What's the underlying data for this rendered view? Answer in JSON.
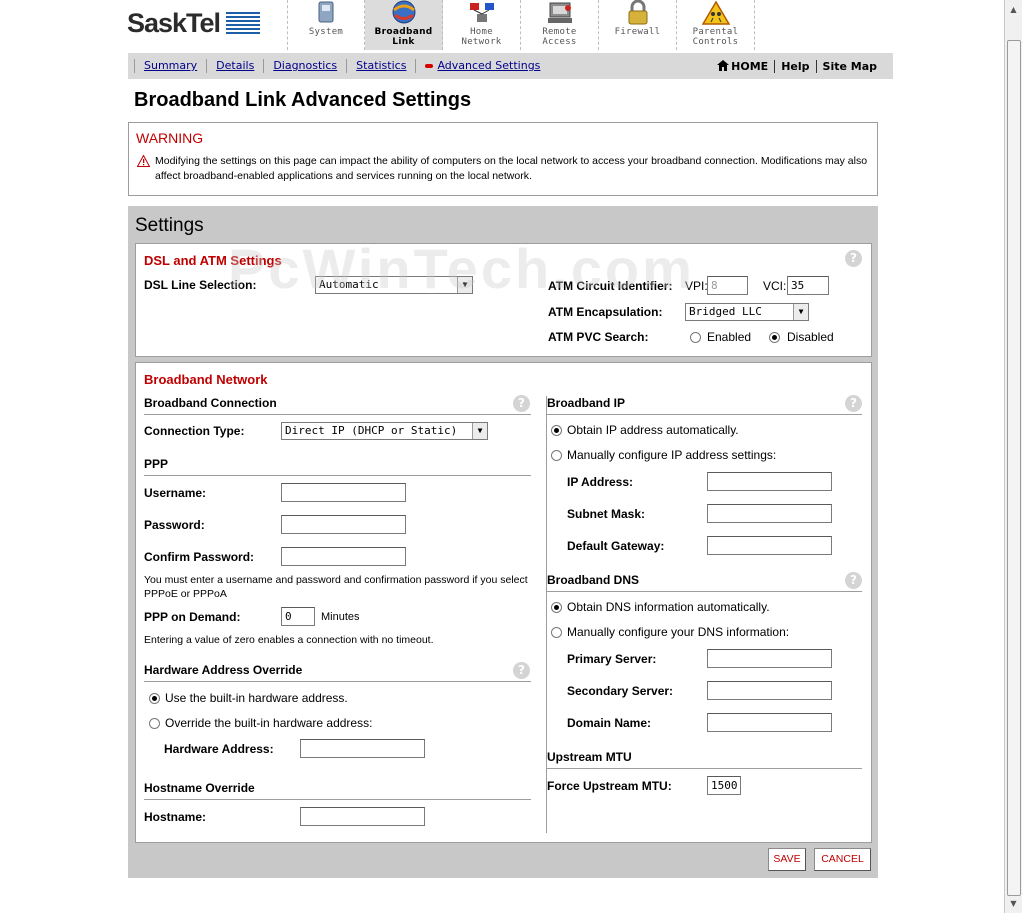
{
  "brand": {
    "name": "SaskTel"
  },
  "top_tabs": [
    {
      "label_line1": "System",
      "label_line2": "",
      "icon": "system-icon",
      "active": false
    },
    {
      "label_line1": "Broadband",
      "label_line2": "Link",
      "icon": "broadband-globe-icon",
      "active": true
    },
    {
      "label_line1": "Home",
      "label_line2": "Network",
      "icon": "home-network-icon",
      "active": false
    },
    {
      "label_line1": "Remote",
      "label_line2": "Access",
      "icon": "remote-access-icon",
      "active": false
    },
    {
      "label_line1": "Firewall",
      "label_line2": "",
      "icon": "firewall-lock-icon",
      "active": false
    },
    {
      "label_line1": "Parental",
      "label_line2": "Controls",
      "icon": "parental-controls-icon",
      "active": false
    }
  ],
  "subnav": {
    "links": [
      "Summary",
      "Details",
      "Diagnostics",
      "Statistics",
      "Advanced Settings"
    ],
    "right": {
      "home": "HOME",
      "help": "Help",
      "sitemap": "Site Map"
    }
  },
  "page_title": "Broadband Link Advanced Settings",
  "warning": {
    "title": "WARNING",
    "text": "Modifying the settings on this page can impact the ability of computers on the local network to access your broadband connection. Modifications may also affect broadband-enabled applications and services running on the local network."
  },
  "watermark": "PcWinTech.com",
  "settings_title": "Settings",
  "dsl": {
    "title": "DSL and ATM Settings",
    "line_selection_label": "DSL Line Selection:",
    "line_selection_value": "Automatic",
    "atm_circuit_label": "ATM Circuit Identifier:",
    "vpi_label": "VPI:",
    "vpi_value": "8",
    "vci_label": "VCI:",
    "vci_value": "35",
    "encapsulation_label": "ATM Encapsulation:",
    "encapsulation_value": "Bridged LLC",
    "pvc_label": "ATM PVC Search:",
    "pvc_enabled": "Enabled",
    "pvc_disabled": "Disabled"
  },
  "broadband": {
    "title": "Broadband Network",
    "connection_group": "Broadband Connection",
    "connection_type_label": "Connection Type:",
    "connection_type_value": "Direct IP (DHCP or Static)",
    "ppp_group": "PPP",
    "username_label": "Username:",
    "password_label": "Password:",
    "confirm_label": "Confirm Password:",
    "ppp_note": "You must enter a username and password and confirmation password if you select PPPoE or PPPoA",
    "ppp_demand_label": "PPP on Demand:",
    "ppp_demand_value": "0",
    "ppp_demand_unit": "Minutes",
    "demand_note": "Entering a value of zero enables a connection with no timeout.",
    "hw_group": "Hardware Address Override",
    "hw_builtin": "Use the built-in hardware address.",
    "hw_override": "Override the built-in hardware address:",
    "hw_address_label": "Hardware Address:",
    "hostname_group": "Hostname Override",
    "hostname_label": "Hostname:",
    "ip_group": "Broadband IP",
    "ip_auto": "Obtain IP address automatically.",
    "ip_manual": "Manually configure IP address settings:",
    "ip_address_label": "IP Address:",
    "subnet_label": "Subnet Mask:",
    "gateway_label": "Default Gateway:",
    "dns_group": "Broadband DNS",
    "dns_auto": "Obtain DNS information automatically.",
    "dns_manual": "Manually configure your DNS information:",
    "primary_label": "Primary Server:",
    "secondary_label": "Secondary Server:",
    "domain_label": "Domain Name:",
    "mtu_group": "Upstream MTU",
    "mtu_label": "Force Upstream MTU:",
    "mtu_value": "1500"
  },
  "buttons": {
    "save": "SAVE",
    "cancel": "CANCEL"
  },
  "help_glyph": "?",
  "colors": {
    "accent_red": "#c00000",
    "link_blue": "#00008b",
    "panel_gray": "#c8c8c8"
  }
}
